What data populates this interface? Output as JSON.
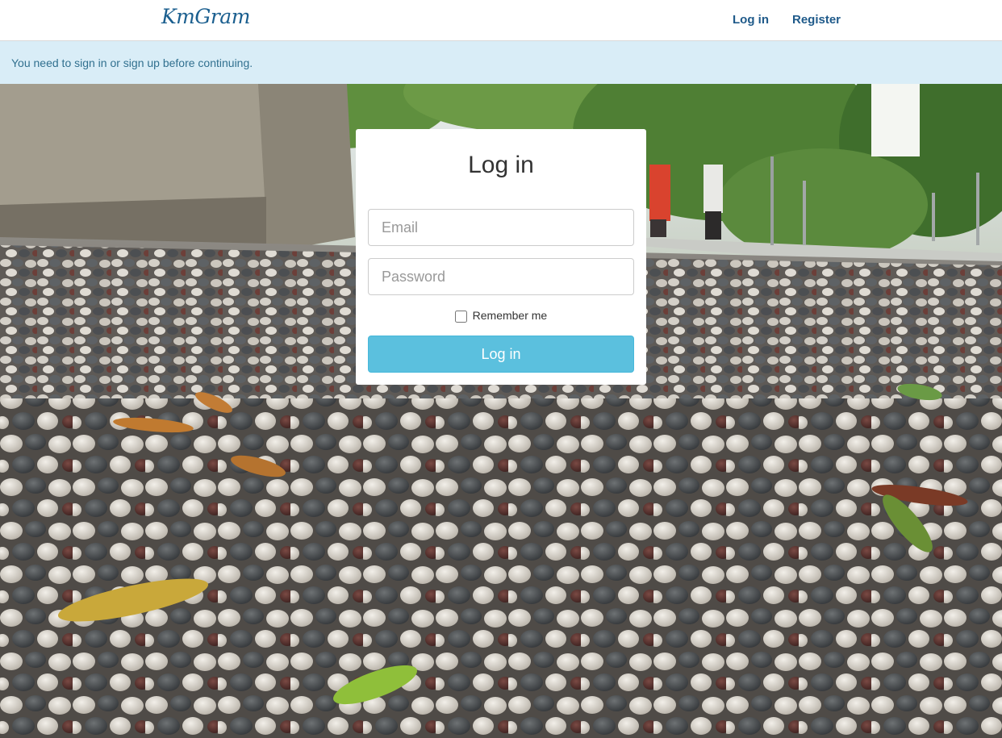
{
  "navbar": {
    "brand": "KmGram",
    "login_link": "Log in",
    "register_link": "Register"
  },
  "alert": {
    "message": "You need to sign in or sign up before continuing."
  },
  "login_form": {
    "title": "Log in",
    "email_placeholder": "Email",
    "password_placeholder": "Password",
    "remember_label": "Remember me",
    "remember_checked": false,
    "submit_label": "Log in"
  },
  "colors": {
    "brand": "#1b5f8f",
    "alert_bg": "#d9edf7",
    "alert_text": "#31708f",
    "button_bg": "#5bc0de"
  }
}
